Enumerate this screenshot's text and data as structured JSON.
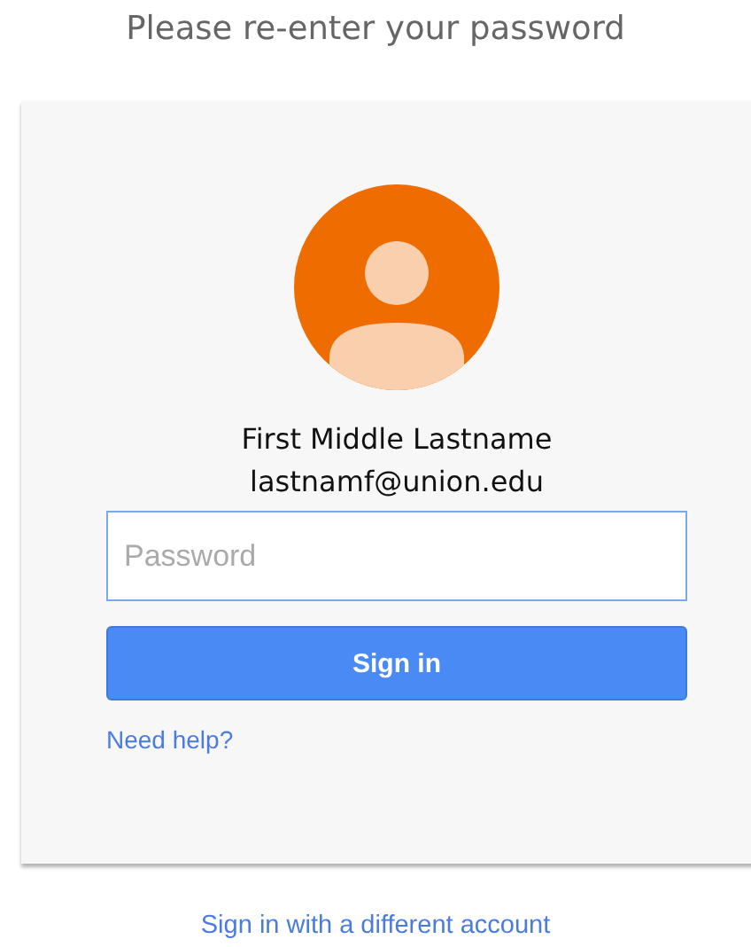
{
  "heading": "Please re-enter your password",
  "account": {
    "name": "First Middle Lastname",
    "email": "lastnamf@union.edu"
  },
  "password_field": {
    "placeholder": "Password"
  },
  "sign_in_button": "Sign in",
  "help_link": "Need help?",
  "switch_account_link": "Sign in with a different account"
}
